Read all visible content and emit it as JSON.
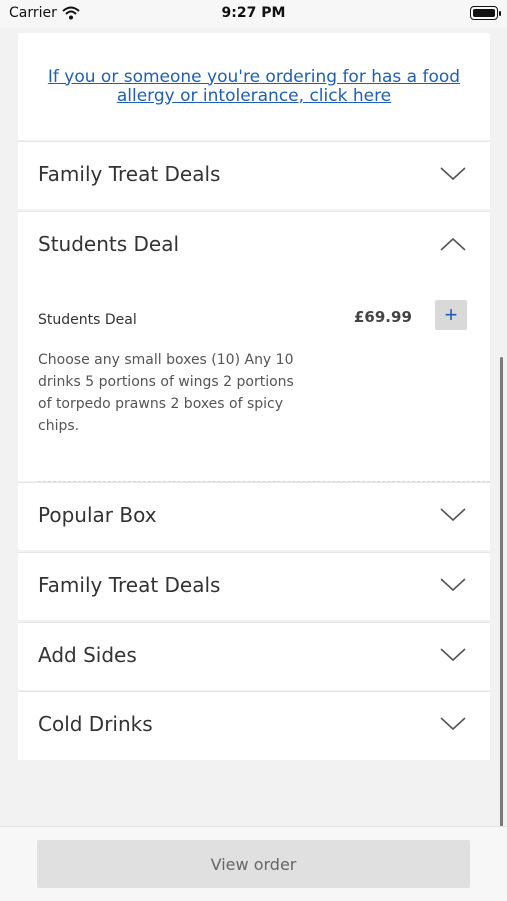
{
  "status_bar": {
    "carrier": "Carrier",
    "time": "9:27 PM"
  },
  "allergy_notice": {
    "text": "If you or someone you're ordering for has a food allergy or intolerance, click here"
  },
  "sections": [
    {
      "title": "Family Treat Deals",
      "expanded": false
    },
    {
      "title": "Students Deal",
      "expanded": true,
      "items": [
        {
          "name": "Students Deal",
          "price": "£69.99",
          "add_label": "+",
          "description": "Choose any small boxes (10) Any 10 drinks 5 portions of wings 2 portions of torpedo prawns 2 boxes of spicy chips."
        }
      ]
    },
    {
      "title": "Popular Box",
      "expanded": false
    },
    {
      "title": "Family Treat Deals",
      "expanded": false
    },
    {
      "title": "Add Sides",
      "expanded": false
    },
    {
      "title": "Cold Drinks",
      "expanded": false
    }
  ],
  "footer": {
    "view_order_label": "View order"
  },
  "colors": {
    "link": "#1d5fb8",
    "background": "#f2f2f2",
    "card": "#ffffff",
    "button": "#e0e0e0"
  }
}
